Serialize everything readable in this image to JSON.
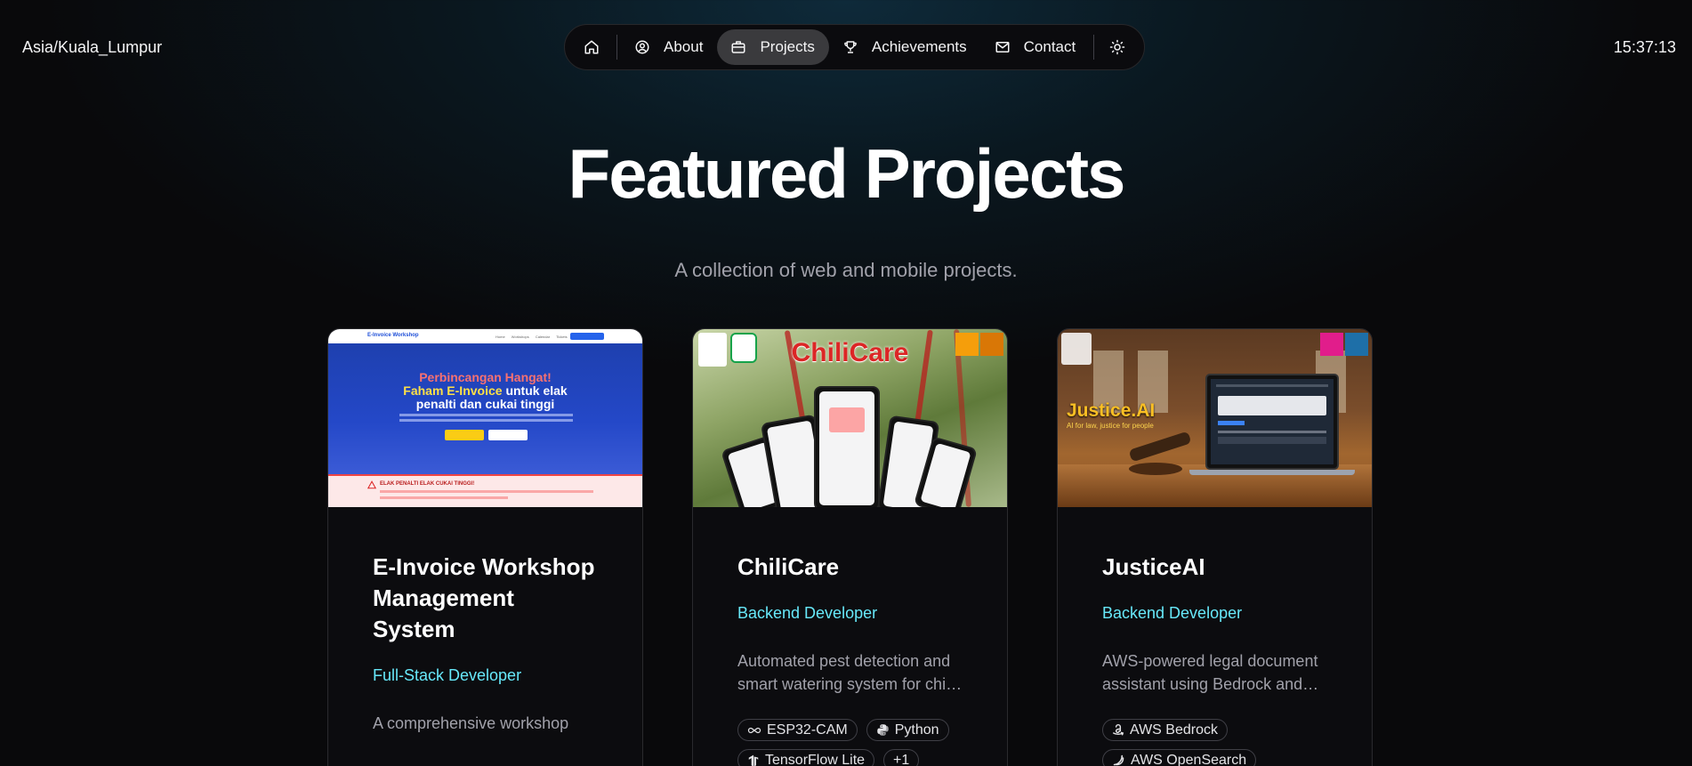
{
  "header": {
    "timezone": "Asia/Kuala_Lumpur",
    "time": "15:37:13"
  },
  "nav": {
    "items": [
      {
        "label": "About",
        "icon": "user-circle-icon"
      },
      {
        "label": "Projects",
        "icon": "briefcase-icon",
        "active": true
      },
      {
        "label": "Achievements",
        "icon": "trophy-icon"
      },
      {
        "label": "Contact",
        "icon": "mail-icon"
      }
    ],
    "home_icon": "home-icon",
    "theme_icon": "sun-icon"
  },
  "page": {
    "title": "Featured Projects",
    "subtitle": "A collection of web and mobile projects."
  },
  "projects": [
    {
      "title": "E-Invoice Workshop Management System",
      "role": "Full-Stack Developer",
      "description": "A comprehensive workshop",
      "thumb": {
        "logo": "E-Invoice Workshop",
        "heading_red": "Perbincangan Hangat!",
        "heading_yellow": "Faham E-Invoice",
        "heading_white_1": "untuk elak",
        "heading_white_2": "penalti dan cukai tinggi",
        "alert": "ELAK PENALTI ELAK CUKAI TINGGI!"
      }
    },
    {
      "title": "ChiliCare",
      "role": "Backend Developer",
      "description": "Automated pest detection and smart watering system for chili plants",
      "tags": [
        {
          "label": "ESP32-CAM",
          "icon": "infinity-icon"
        },
        {
          "label": "Python",
          "icon": "python-icon"
        },
        {
          "label": "TensorFlow Lite",
          "icon": "tensorflow-icon"
        },
        {
          "label": "+1",
          "icon": ""
        }
      ],
      "thumb": {
        "brand": "ChiliCare"
      }
    },
    {
      "title": "JusticeAI",
      "role": "Backend Developer",
      "description": "AWS-powered legal document assistant using Bedrock and OpenSearch",
      "tags": [
        {
          "label": "AWS Bedrock",
          "icon": "amazon-icon"
        },
        {
          "label": "AWS OpenSearch",
          "icon": "opensearch-icon"
        }
      ],
      "thumb": {
        "brand": "Justice.AI",
        "tagline": "AI for law, justice for people"
      }
    }
  ],
  "colors": {
    "accent": "#67e8f9",
    "background": "#09090b",
    "card_border": "#2a2a2e",
    "nav_active": "#3a3a3d"
  }
}
